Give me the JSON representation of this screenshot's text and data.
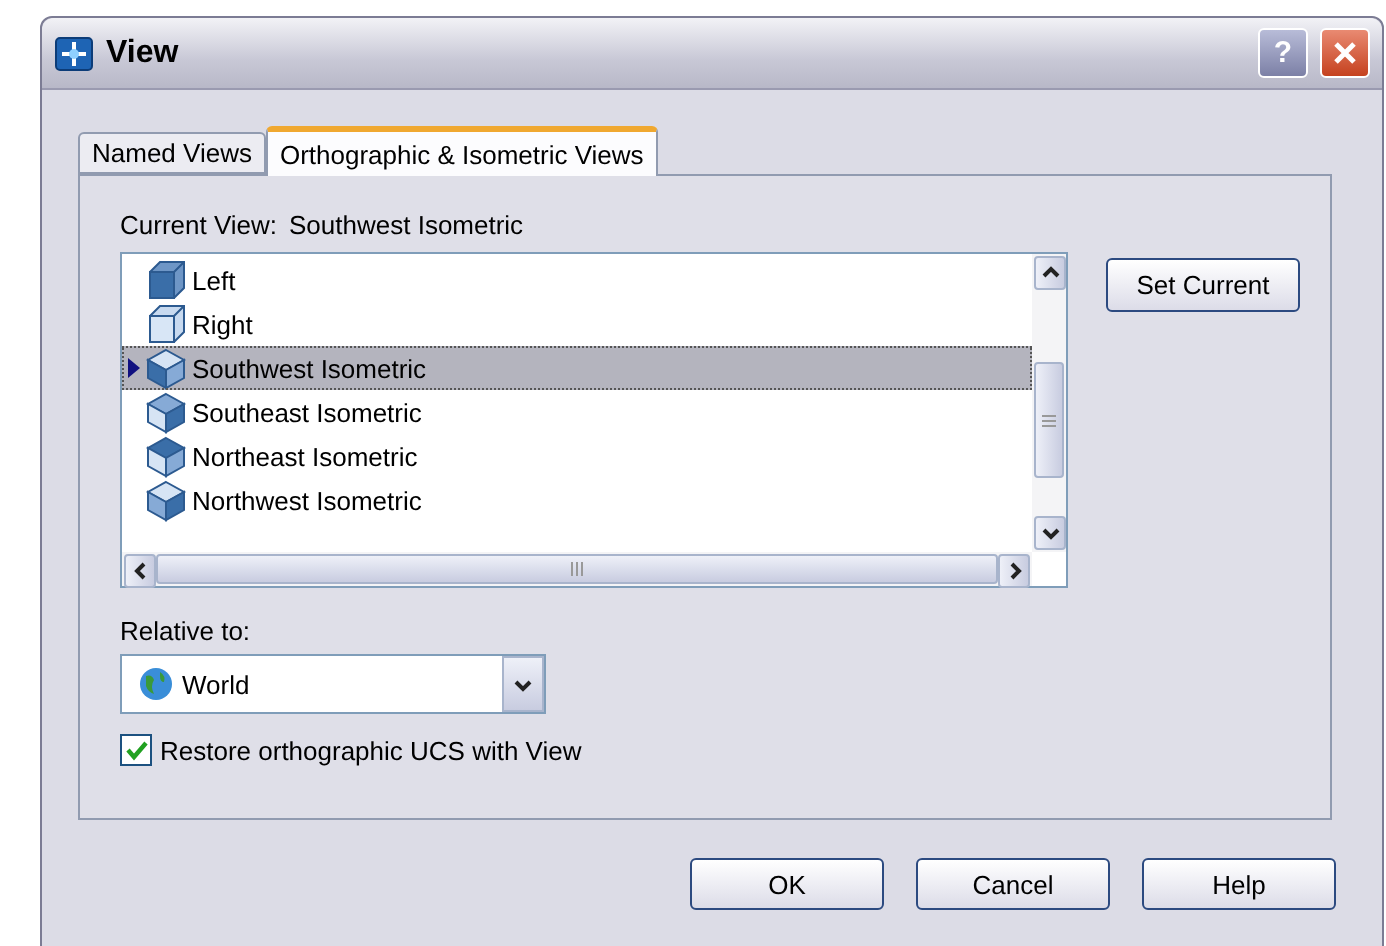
{
  "window": {
    "title": "View"
  },
  "title_buttons": [
    {
      "label": "?",
      "kind": "help"
    },
    {
      "kind": "close"
    }
  ],
  "tabs": [
    {
      "label": "Named Views",
      "selected": false
    },
    {
      "label": "Orthographic & Isometric Views",
      "selected": true
    }
  ],
  "current_view": {
    "label": "Current View:",
    "value": "Southwest Isometric"
  },
  "views": [
    {
      "name": "Left",
      "selected": false
    },
    {
      "name": "Right",
      "selected": false
    },
    {
      "name": "Southwest Isometric",
      "selected": true
    },
    {
      "name": "Southeast Isometric",
      "selected": false
    },
    {
      "name": "Northeast Isometric",
      "selected": false
    },
    {
      "name": "Northwest Isometric",
      "selected": false
    }
  ],
  "set_current_button": "Set Current",
  "relative_to": {
    "label": "Relative to:",
    "value": "World"
  },
  "restore_ucs": {
    "label": "Restore orthographic UCS with View",
    "checked": true
  },
  "buttons": [
    "OK",
    "Cancel",
    "Help"
  ]
}
